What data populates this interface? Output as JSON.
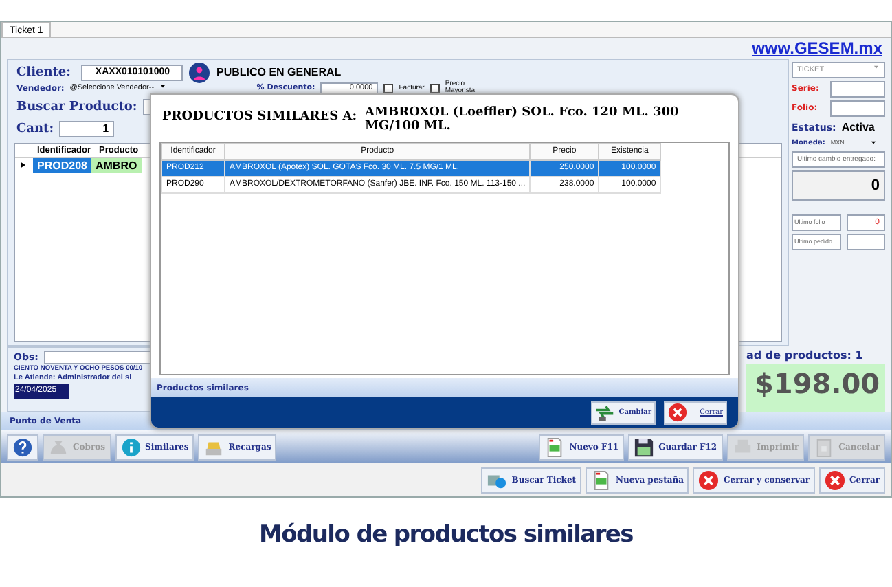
{
  "tab": {
    "label": "Ticket 1",
    "selected": true
  },
  "link": "www.GESEM.mx",
  "client": {
    "label": "Cliente:",
    "value": "XAXX010101000",
    "name": "PUBLICO EN GENERAL"
  },
  "seller": {
    "label": "Vendedor:",
    "value": "@Seleccione Vendedor--"
  },
  "discount": {
    "label": "% Descuento:",
    "value": "0.0000"
  },
  "checks": [
    {
      "label": "Facturar",
      "checked": false
    },
    {
      "label": "Precio Mayorista",
      "checked": false
    }
  ],
  "search": {
    "label": "Buscar Producto:"
  },
  "qty": {
    "label": "Cant:",
    "value": "1"
  },
  "grid": {
    "columns": [
      "Identificador",
      "Producto"
    ],
    "rows": [
      {
        "cells": [
          "PROD208",
          "AMBRO"
        ]
      }
    ]
  },
  "obs": {
    "label": "Obs:"
  },
  "amount_words": "CIENTO NOVENTA Y OCHO PESOS  00/10",
  "attendant": "Le Atiende: Administrador del si",
  "date": "24/04/2025",
  "count_label": "ad de productos: 1",
  "total": "$198.00",
  "side": {
    "doc_type": "TICKET",
    "serie_label": "Serie:",
    "folio_label": "Folio:",
    "status_label": "Estatus:",
    "status": "Activa",
    "currency_label": "Moneda:",
    "currency": "MXN",
    "change_label": "Ultimo cambio entregado:",
    "change": "0",
    "last_folio_label": "Ultimo folio",
    "last_folio": "0",
    "last_order_label": "Ultimo pedido"
  },
  "section": "Punto de Venta",
  "toolbar_left": [
    {
      "kind": "help",
      "disabled": false
    },
    {
      "kind": "money",
      "label": "Cobros",
      "disabled": true
    },
    {
      "kind": "info",
      "label": "Similares",
      "disabled": false
    },
    {
      "kind": "register",
      "label": "Recargas",
      "disabled": false
    }
  ],
  "toolbar_right": [
    {
      "kind": "new",
      "label": "Nuevo F11",
      "disabled": false
    },
    {
      "kind": "save",
      "label": "Guardar F12",
      "disabled": false
    },
    {
      "kind": "print",
      "label": "Imprimir",
      "disabled": true
    },
    {
      "kind": "cancel",
      "label": "Cancelar",
      "disabled": true
    }
  ],
  "bottom_buttons": [
    {
      "kind": "find",
      "label": "Buscar Ticket"
    },
    {
      "kind": "new",
      "label": "Nueva pestaña"
    },
    {
      "kind": "close",
      "label": "Cerrar y conservar"
    },
    {
      "kind": "close",
      "label": "Cerrar"
    }
  ],
  "dialog": {
    "title_label": "PRODUCTOS SIMILARES A:",
    "product": "AMBROXOL (Loeffler) SOL. Fco. 120 ML. 300 MG/100 ML.",
    "columns": [
      "Identificador",
      "Producto",
      "Precio",
      "Existencia"
    ],
    "rows": [
      {
        "cells": [
          "PROD212",
          "AMBROXOL (Apotex) SOL. GOTAS Fco. 30 ML. 7.5 MG/1 ML.",
          "250.0000",
          "100.0000"
        ],
        "selected": true
      },
      {
        "cells": [
          "PROD290",
          "AMBROXOL/DEXTROMETORFANO (Sanfer) JBE. INF. Fco. 150 ML. 113-150 ...",
          "238.0000",
          "100.0000"
        ],
        "selected": false
      }
    ],
    "status": "Productos similares",
    "buttons": [
      {
        "kind": "change",
        "label": "Cambiar"
      },
      {
        "kind": "close",
        "label": "Cerrar"
      }
    ]
  },
  "caption": "Módulo de productos similares"
}
